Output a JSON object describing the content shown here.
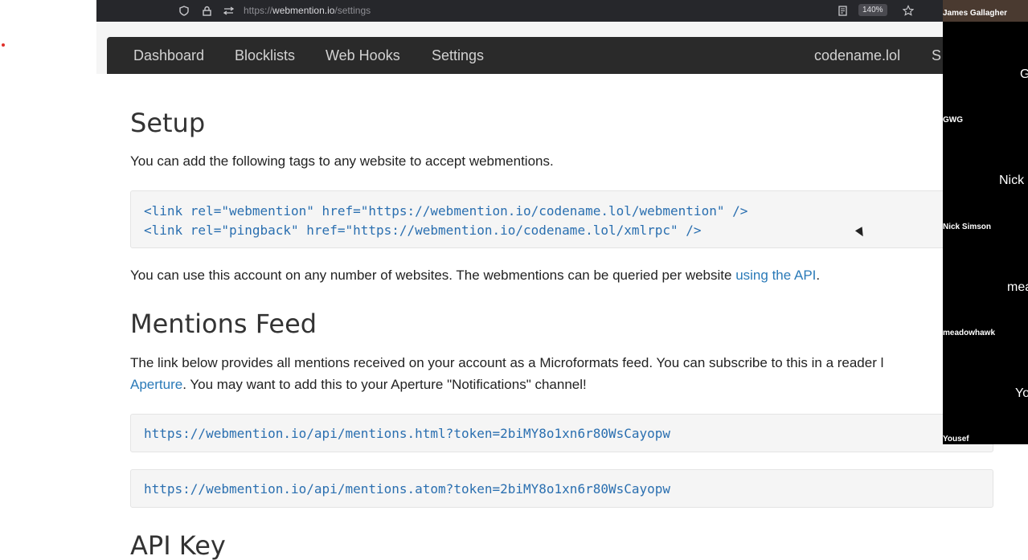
{
  "browser": {
    "url_prefix": "https://",
    "url_domain": "webmention.io",
    "url_path": "/settings",
    "zoom": "140%"
  },
  "nav": {
    "dashboard": "Dashboard",
    "blocklists": "Blocklists",
    "webhooks": "Web Hooks",
    "settings": "Settings",
    "account": "codename.lol",
    "signout": "S"
  },
  "setup": {
    "heading": "Setup",
    "intro": "You can add the following tags to any website to accept webmentions.",
    "code_line1": "<link rel=\"webmention\" href=\"https://webmention.io/codename.lol/webmention\" />",
    "code_line2": "<link rel=\"pingback\" href=\"https://webmention.io/codename.lol/xmlrpc\" />",
    "api_text": "You can use this account on any number of websites. The webmentions can be queried per website ",
    "api_link": "using the API",
    "api_end": "."
  },
  "feed": {
    "heading": "Mentions Feed",
    "line1": "The link below provides all mentions received on your account as a Microformats feed. You can subscribe to this in a reader l",
    "aperture_link": "Aperture",
    "line2": ". You may want to add this to your Aperture \"Notifications\" channel!",
    "html_url": "https://webmention.io/api/mentions.html?token=2biMY8o1xn6r80WsCayopw",
    "atom_url": "https://webmention.io/api/mentions.atom?token=2biMY8o1xn6r80WsCayopw"
  },
  "apikey": {
    "heading": "API Key"
  },
  "participants": {
    "p1": "James Gallagher",
    "p2_big": "G",
    "p2": "GWG",
    "p3_big": "Nick",
    "p3": "Nick Simson",
    "p4_big": "mead",
    "p4": "meadowhawk",
    "p5_big": "Yo",
    "p5": "Yousef"
  }
}
